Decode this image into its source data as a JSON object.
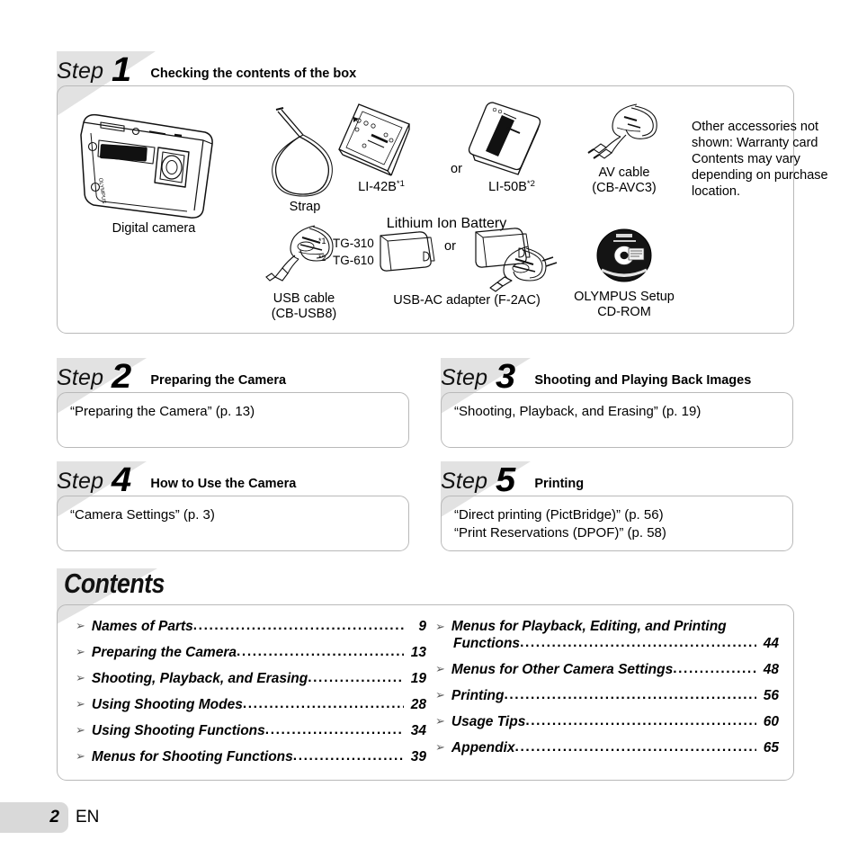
{
  "page": {
    "number": "2",
    "language": "EN"
  },
  "step1": {
    "step_word": "Step",
    "step_number": "1",
    "title": "Checking the contents of the box",
    "parts": [
      {
        "name": "digital-camera",
        "caption_line1": "Digital camera",
        "caption_line2": ""
      },
      {
        "name": "strap",
        "caption_line1": "Strap",
        "caption_line2": ""
      },
      {
        "name": "battery-li42b",
        "caption_line1": "LI-42B",
        "superscript": "*1",
        "caption_line2": ""
      },
      {
        "name": "battery-li50b",
        "caption_line1": "LI-50B",
        "superscript": "*2",
        "caption_line2": ""
      },
      {
        "name": "av-cable",
        "caption_line1": "AV cable",
        "caption_line2": "(CB-AVC3)"
      },
      {
        "name": "usb-cable",
        "caption_line1": "USB cable",
        "caption_line2": "(CB-USB8)"
      },
      {
        "name": "usb-ac-adapter",
        "caption_line1": "USB-AC adapter (F-2AC)",
        "caption_line2": ""
      },
      {
        "name": "cd-rom",
        "caption_line1": "OLYMPUS Setup",
        "caption_line2": "CD-ROM"
      }
    ],
    "battery_group_label": "Lithium Ion Battery",
    "or_label_battery": "or",
    "or_label_adapter": "or",
    "footnotes": [
      {
        "marker": "*1",
        "text": "TG-310"
      },
      {
        "marker": "*2",
        "text": "TG-610"
      }
    ],
    "note": "Other accessories not shown: Warranty card Contents may vary depending on purchase location."
  },
  "step2": {
    "step_word": "Step",
    "step_number": "2",
    "title": "Preparing the Camera",
    "lines": [
      "“Preparing the Camera” (p. 13)"
    ]
  },
  "step3": {
    "step_word": "Step",
    "step_number": "3",
    "title": "Shooting and Playing Back Images",
    "lines": [
      "“Shooting, Playback, and Erasing” (p. 19)"
    ]
  },
  "step4": {
    "step_word": "Step",
    "step_number": "4",
    "title": "How to Use the Camera",
    "lines": [
      "“Camera Settings” (p. 3)"
    ]
  },
  "step5": {
    "step_word": "Step",
    "step_number": "5",
    "title": "Printing",
    "lines": [
      "“Direct printing (PictBridge)” (p. 56)",
      "“Print Reservations (DPOF)” (p. 58)"
    ]
  },
  "contents": {
    "title": "Contents",
    "bullet": "➢",
    "left_column": [
      {
        "label": "Names of Parts",
        "page": "9"
      },
      {
        "label": "Preparing the Camera",
        "page": "13"
      },
      {
        "label": "Shooting, Playback, and Erasing",
        "page": "19"
      },
      {
        "label": "Using Shooting Modes",
        "page": "28"
      },
      {
        "label": "Using Shooting Functions",
        "page": "34"
      },
      {
        "label": "Menus for Shooting Functions",
        "page": "39"
      }
    ],
    "right_column": [
      {
        "label": "Menus for Playback, Editing, and Printing",
        "label_line2": "Functions",
        "page": "44",
        "wrap": true
      },
      {
        "label": "Menus for Other Camera Settings",
        "page": "48"
      },
      {
        "label": "Printing",
        "page": "56"
      },
      {
        "label": "Usage Tips",
        "page": "60"
      },
      {
        "label": "Appendix",
        "page": "65"
      }
    ]
  },
  "colors": {
    "pennant_gray": "#e2e2e2",
    "box_border": "#b9b9b9",
    "footer_tab_gray": "#d9d9d9",
    "text": "#000000"
  }
}
